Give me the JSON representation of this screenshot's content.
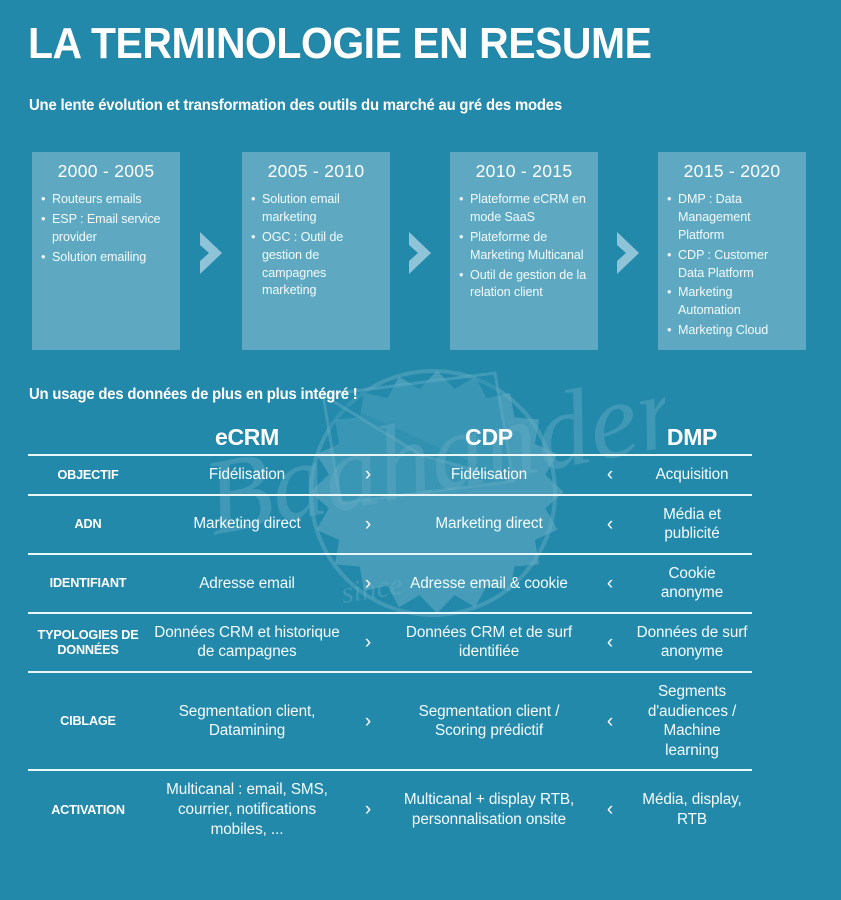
{
  "header": {
    "title": "LA TERMINOLOGIE EN RESUME",
    "subtitle": "Une lente évolution et transformation des outils du marché au gré des modes"
  },
  "timeline": {
    "separator_icon": "chevron-right-icon",
    "eras": [
      {
        "period": "2000 - 2005",
        "items": [
          "Routeurs emails",
          "ESP : Email service provider",
          "Solution emailing"
        ]
      },
      {
        "period": "2005 - 2010",
        "items": [
          "Solution email marketing",
          "OGC : Outil de gestion de campagnes marketing"
        ]
      },
      {
        "period": "2010 - 2015",
        "items": [
          "Plateforme eCRM en mode SaaS",
          "Plateforme de Marketing Multicanal",
          "Outil de gestion de la relation client"
        ]
      },
      {
        "period": "2015 - 2020",
        "items": [
          "DMP : Data Management Platform",
          "CDP : Customer Data Platform",
          "Marketing Automation",
          "Marketing Cloud"
        ]
      }
    ]
  },
  "comparison": {
    "section_title": "Un usage des données de plus en plus intégré !",
    "columns": [
      "eCRM",
      "CDP",
      "DMP"
    ],
    "arrow_left_icon": "chevron-left-icon",
    "arrow_right_icon": "chevron-right-icon",
    "rows": [
      {
        "label": "OBJECTIF",
        "ecrm": "Fidélisation",
        "arrow1": "›",
        "cdp": "Fidélisation",
        "arrow2": "‹",
        "dmp": "Acquisition"
      },
      {
        "label": "ADN",
        "ecrm": "Marketing direct",
        "arrow1": "›",
        "cdp": "Marketing direct",
        "arrow2": "‹",
        "dmp": "Média et publicité"
      },
      {
        "label": "IDENTIFIANT",
        "ecrm": "Adresse email",
        "arrow1": "›",
        "cdp": "Adresse email & cookie",
        "arrow2": "‹",
        "dmp": "Cookie anonyme"
      },
      {
        "label": "TYPOLOGIES DE DONNÉES",
        "ecrm": "Données CRM et historique de campagnes",
        "arrow1": "›",
        "cdp": "Données CRM et de surf identifiée",
        "arrow2": "‹",
        "dmp": "Données de surf anonyme"
      },
      {
        "label": "CIBLAGE",
        "ecrm": "Segmentation client, Datamining",
        "arrow1": "›",
        "cdp": "Segmentation client / Scoring prédictif",
        "arrow2": "‹",
        "dmp": "Segments d'audiences / Machine learning"
      },
      {
        "label": "ACTIVATION",
        "ecrm": "Multicanal : email, SMS, courrier, notifications mobiles, ...",
        "arrow1": "›",
        "cdp": "Multicanal + display RTB, personnalisation onsite",
        "arrow2": "‹",
        "dmp": "Média, display, RTB"
      }
    ]
  },
  "colors": {
    "background": "#2389ab",
    "box": "#6fb2cb",
    "text": "#ffffff",
    "rule": "#e9f6fa"
  },
  "watermark": {
    "icon": "envelope-badge-watermark"
  }
}
